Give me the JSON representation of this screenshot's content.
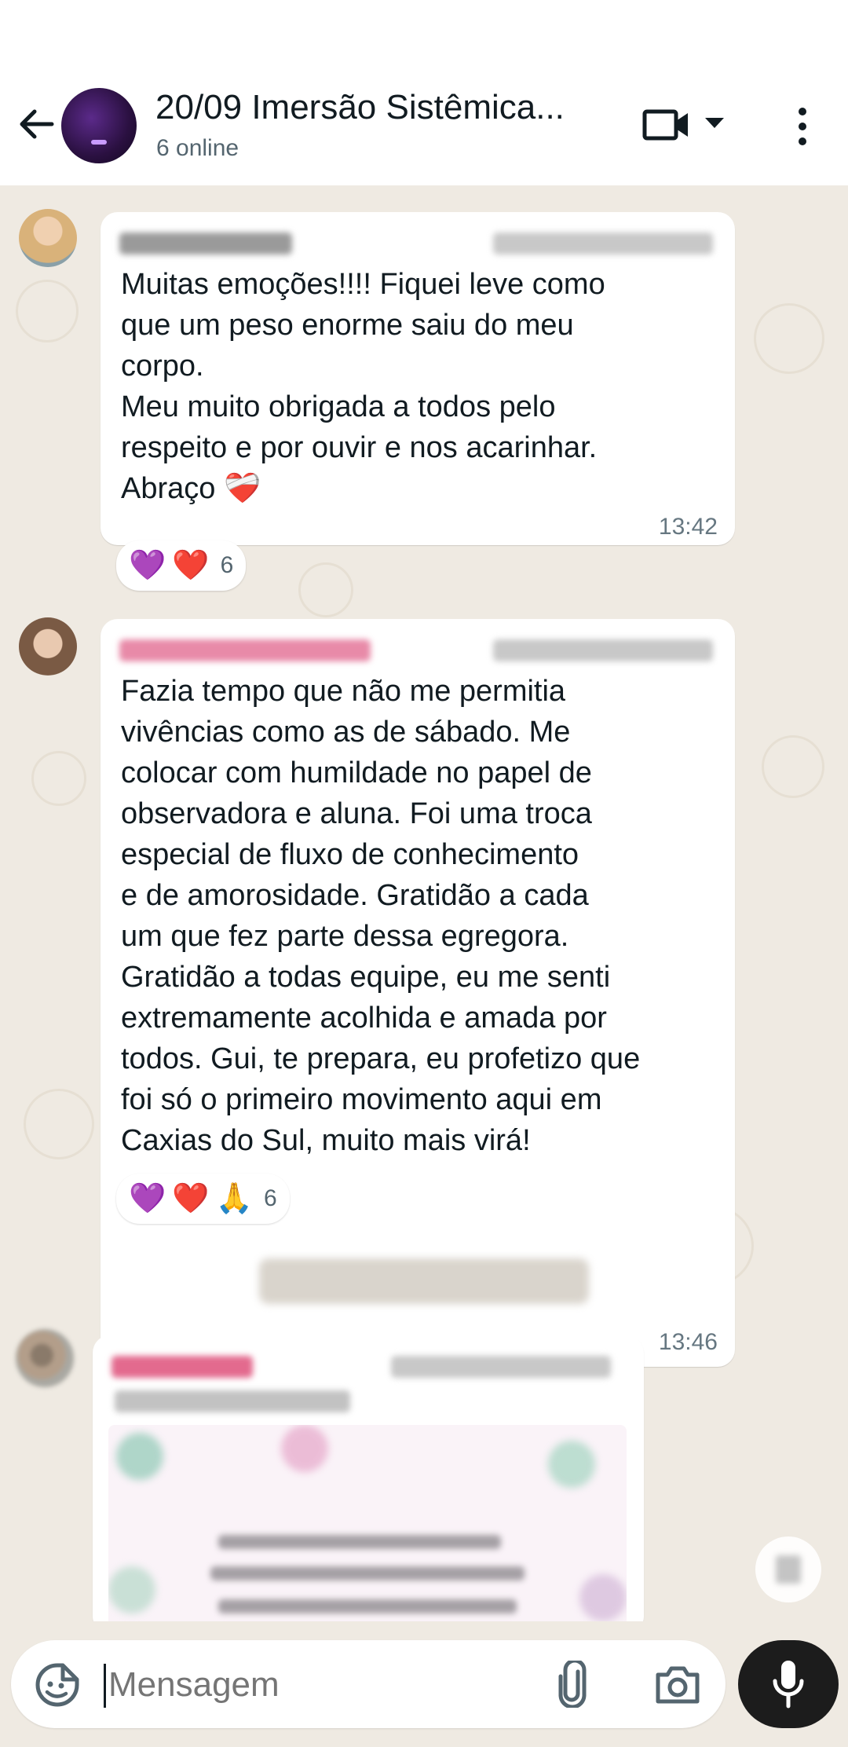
{
  "header": {
    "title": "20/09 Imersão Sistêmica...",
    "subtitle": "6 online"
  },
  "messages": [
    {
      "text": "Muitas emoções!!!!  Fiquei leve como\nque um peso enorme saiu do meu\ncorpo.\nMeu muito obrigada a todos pelo\nrespeito e por ouvir e nos acarinhar.\nAbraço ❤️‍🩹",
      "time": "13:42",
      "reactions": {
        "emojis": [
          "💜",
          "❤️"
        ],
        "count": "6"
      },
      "sender_color": "#9a9a9a"
    },
    {
      "text": "Fazia tempo que não me permitia\nvivências como as de sábado. Me\ncolocar com humildade no papel de\nobservadora e aluna. Foi uma troca\nespecial de fluxo de conhecimento\ne de amorosidade. Gratidão a cada\num que fez parte dessa egregora.\nGratidão a todas equipe, eu me senti\nextremamente acolhida e amada por\ntodos. Gui, te prepara, eu profetizo que\nfoi só o primeiro movimento aqui em\nCaxias do Sul, muito mais virá!",
      "time": "13:46",
      "reactions": {
        "emojis": [
          "💜",
          "❤️",
          "🙏"
        ],
        "count": "6"
      },
      "sender_color": "#e88aa8"
    },
    {
      "sender_color": "#e36a8e"
    }
  ],
  "input": {
    "placeholder": "Mensagem"
  },
  "icons": {
    "back": "arrow-left-icon",
    "video": "video-call-icon",
    "menu": "kebab-menu-icon",
    "sticker": "sticker-icon",
    "attach": "paperclip-icon",
    "camera": "camera-icon",
    "mic": "microphone-icon"
  },
  "colors": {
    "wallpaper": "#efeae2",
    "bubble": "#ffffff",
    "mic_button": "#1c1c1c"
  }
}
